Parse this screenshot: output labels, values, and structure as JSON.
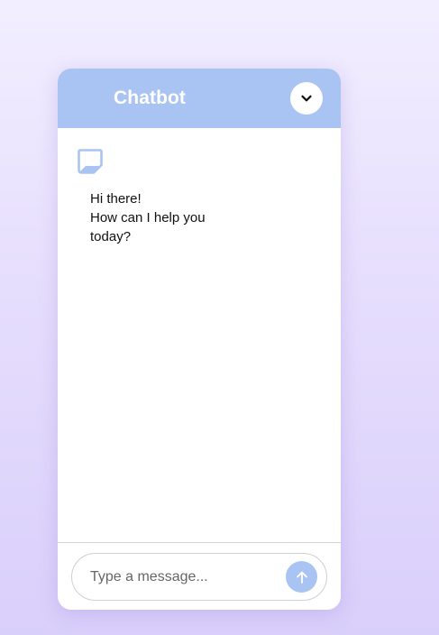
{
  "chat": {
    "title": "Chatbot",
    "greeting_lines": [
      "Hi there!",
      "How can I help you",
      "today?"
    ]
  },
  "input": {
    "placeholder": "Type a message..."
  },
  "icons": {
    "collapse": "chevron-down-icon",
    "bot": "chat-bubble-icon",
    "send": "arrow-up-icon"
  },
  "colors": {
    "accent": "#a9c4f2",
    "background_top": "#f2eeff",
    "background_bottom": "#d9cffb",
    "panel": "#ffffff"
  }
}
